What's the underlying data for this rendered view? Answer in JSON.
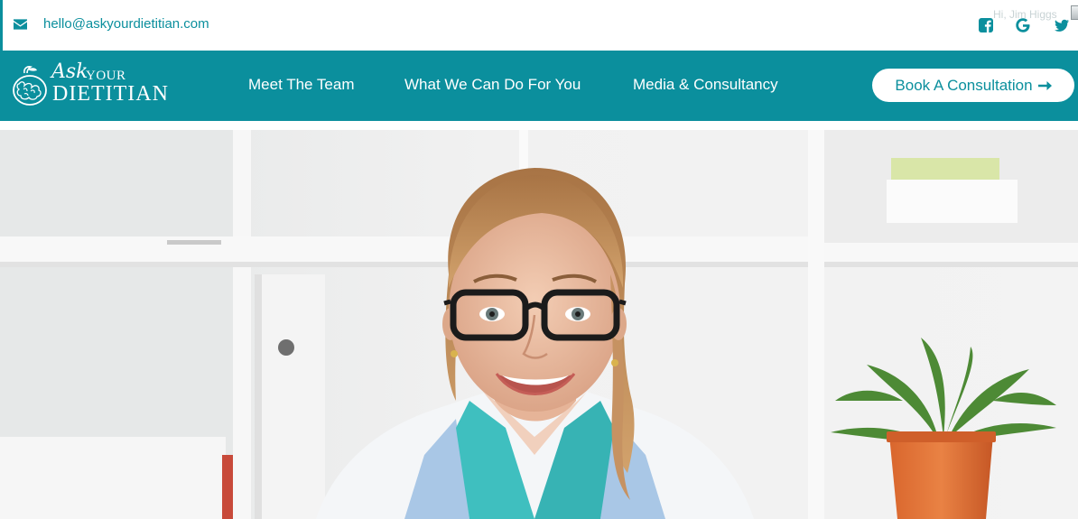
{
  "topbar": {
    "email": "hello@askyourdietitian.com",
    "greeting": "Hi, Jim Higgs",
    "icons": {
      "email": "envelope-icon",
      "facebook": "facebook-icon",
      "google": "google-icon",
      "twitter": "twitter-icon"
    }
  },
  "brand": {
    "ask": "Ask",
    "your": "YOUR",
    "dietitian": "DIETITIAN"
  },
  "nav": {
    "items": [
      {
        "label": "Meet The Team"
      },
      {
        "label": "What We Can Do For You"
      },
      {
        "label": "Media & Consultancy"
      }
    ],
    "cta_label": "Book A Consultation"
  },
  "colors": {
    "brand_teal": "#0b8f9d",
    "white": "#ffffff"
  }
}
